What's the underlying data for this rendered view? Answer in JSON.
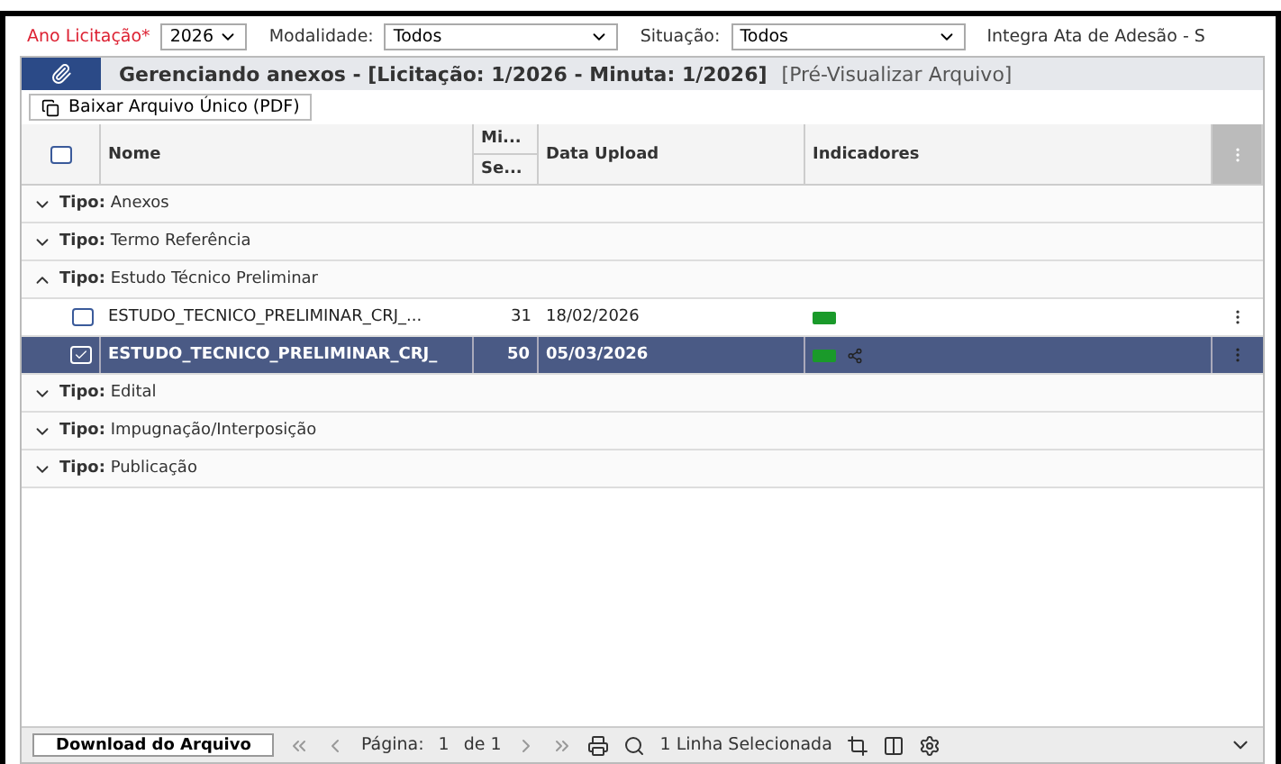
{
  "filters": [
    {
      "label": "Ano Licitação*",
      "required": true,
      "value": "2026"
    },
    {
      "label": "Modalidade:",
      "required": false,
      "value": "Todos"
    },
    {
      "label": "Situação:",
      "required": false,
      "value": "Todos"
    }
  ],
  "filter_extra": "Integra Ata de Adesão - S",
  "dialog": {
    "title": "Gerenciando anexos - [Licitação: 1/2026 - Minuta: 1/2026]",
    "subtitle": "[Pré-Visualizar Arquivo]"
  },
  "toolbar": {
    "button": "Baixar Arquivo Único (PDF)"
  },
  "table": {
    "select_all_checked": false,
    "columns": [
      "Nome",
      "Mi...",
      "Se...",
      "Data Upload",
      "Indicadores"
    ],
    "groups": [
      {
        "prefix": "Tipo:",
        "name": "Anexos",
        "expanded": false
      },
      {
        "prefix": "Tipo:",
        "name": "Termo Referência",
        "expanded": false
      },
      {
        "prefix": "Tipo:",
        "name": "Estudo Técnico Preliminar",
        "expanded": true,
        "rows": [
          {
            "name": "ESTUDO_TECNICO_PRELIMINAR_CRJ_...",
            "number": "31",
            "date": "18/02/2026",
            "selected": false,
            "shared": false
          },
          {
            "name": "ESTUDO_TECNICO_PRELIMINAR_CRJ_",
            "number": "50",
            "date": "05/03/2026",
            "selected": true,
            "shared": true
          }
        ]
      },
      {
        "prefix": "Tipo:",
        "name": "Edital",
        "expanded": false
      },
      {
        "prefix": "Tipo:",
        "name": "Impugnação/Interposição",
        "expanded": false
      },
      {
        "prefix": "Tipo:",
        "name": "Publicação",
        "expanded": false
      }
    ]
  },
  "footer": {
    "download": "Download do Arquivo",
    "page_label": "Página:",
    "page": "1",
    "of": "de 1",
    "selection": "1 Linha Selecionada"
  }
}
